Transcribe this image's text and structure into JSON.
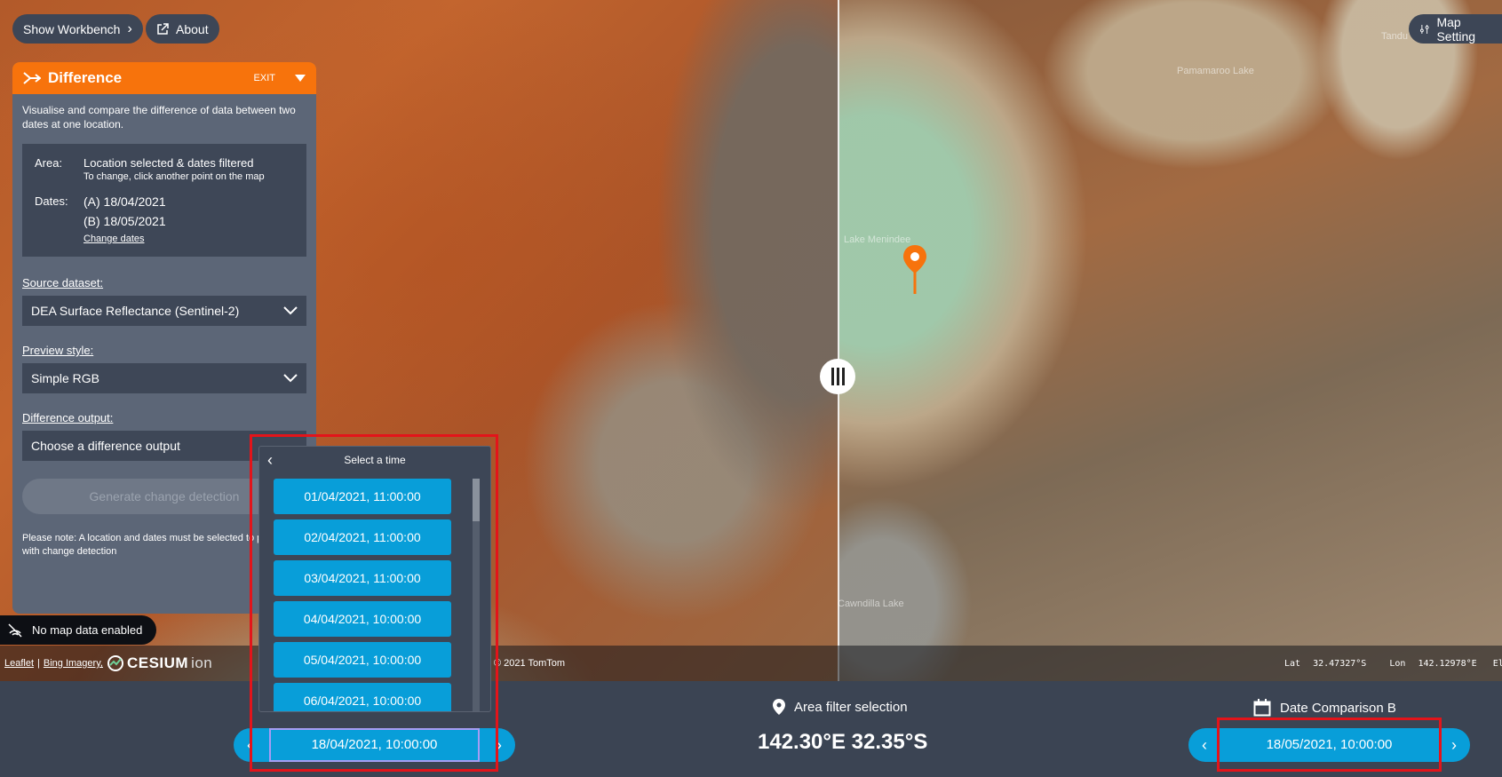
{
  "top_buttons": {
    "workbench_label": "Show Workbench",
    "about_label": "About",
    "map_settings_label": "Map Setting"
  },
  "map": {
    "labels": [
      "Pamamaroo Lake",
      "Tandu",
      "Lake Menindee",
      "Cawndilla Lake"
    ]
  },
  "panel": {
    "title": "Difference",
    "exit_label": "EXIT",
    "description": "Visualise and compare the difference of data between two dates at one location.",
    "area_key": "Area:",
    "area_value": "Location selected & dates filtered",
    "area_hint": "To change, click another point on the map",
    "dates_key": "Dates:",
    "date_a": "(A) 18/04/2021",
    "date_b": "(B) 18/05/2021",
    "change_dates_link": "Change dates",
    "source_label": "Source dataset:",
    "source_value": "DEA Surface Reflectance (Sentinel-2)",
    "preview_label": "Preview style:",
    "preview_value": "Simple RGB",
    "output_label": "Difference output:",
    "output_value": "Choose a difference output",
    "generate_label": "Generate change detection",
    "note": "Please note: A location and dates must be selected to proceed with change detection"
  },
  "no_map_data_label": "No map data enabled",
  "attribution": {
    "leaflet": "Leaflet",
    "bing": "Bing Imagery,",
    "cesium": "CESIUM",
    "ion": "ion",
    "tomtom": "© 2021 TomTom",
    "lat_label": "Lat",
    "lat_value": "32.47327°S",
    "lon_label": "Lon",
    "lon_value": "142.12978°E",
    "elev_label": "Ele"
  },
  "time_picker": {
    "title": "Select a time",
    "times": [
      "01/04/2021, 11:00:00",
      "02/04/2021, 11:00:00",
      "03/04/2021, 11:00:00",
      "04/04/2021, 10:00:00",
      "05/04/2021, 10:00:00",
      "06/04/2021, 10:00:00"
    ]
  },
  "bottom": {
    "area_filter_label": "Area filter selection",
    "area_coords": "142.30°E 32.35°S",
    "date_comparison_b_label": "Date Comparison B",
    "date_a_value": "18/04/2021, 10:00:00",
    "date_b_value": "18/05/2021, 10:00:00"
  },
  "colors": {
    "accent_orange": "#f7730c",
    "date_blue": "#089ed9",
    "highlight_red": "#e3141a"
  }
}
